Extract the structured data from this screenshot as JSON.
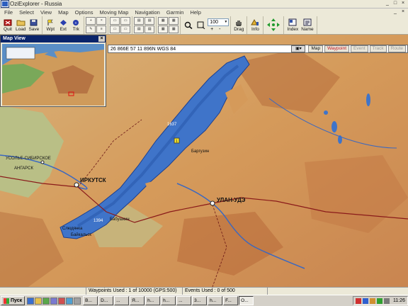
{
  "window": {
    "title": "OziExplorer - Russia",
    "controls": [
      "_",
      "□",
      "×"
    ]
  },
  "menu": {
    "items": [
      "File",
      "Select",
      "View",
      "Map",
      "Options",
      "Moving Map",
      "Navigation",
      "Garmin",
      "Help"
    ]
  },
  "toolbar": {
    "quit_label": "Quit",
    "load_label": "Load",
    "save_label": "Save",
    "wpt_label": "Wpt",
    "ext_label": "Ext",
    "trk_label": "Trk",
    "drag_label": "Drag",
    "info_label": "Info",
    "index_label": "Index",
    "name_label": "Name",
    "zoom_value": "100",
    "zoom_pm": "+-"
  },
  "mapview": {
    "title": "Map View",
    "close": "×"
  },
  "coords": {
    "text": "26 866E    57 11 896N  WGS 84",
    "modes": [
      "Map",
      "Waypoint",
      "Event",
      "Track",
      "Route"
    ],
    "active_mode": "Waypoint"
  },
  "map_labels": {
    "irkutsk": "ИРКУТСК",
    "ulan_ude": "УЛАН-УДЭ",
    "usolye": "УСОЛЬЕ-СИБИРСКОЕ",
    "angarsk": "АНГАРСК",
    "babushkin": "Бабушкин",
    "slyudyanka": "Слюдянка",
    "baikalsk": "Байкальск",
    "depth1": "1394",
    "depth2": "1637",
    "ulan_label": "Улан-Удэ",
    "barguzin": "Баргузин",
    "point_label": "1"
  },
  "statusbar": {
    "waypoints": "Waypoints Used : 1 of 10000  (GPS:500)",
    "events": "Events Used : 0 of 500"
  },
  "taskbar": {
    "start": "Пуск",
    "tasks": [
      "B...",
      "D...",
      "...",
      "Я...",
      "h...",
      "h...",
      "...",
      "3...",
      "h...",
      "F...",
      "O..."
    ],
    "active_task": "O...",
    "clock": "11:26"
  },
  "colors": {
    "water": "#3f74c9",
    "land": "#d9a468",
    "mountain": "#b86a3a",
    "active_mode": "#c0121c",
    "title_blue": "#0a246a"
  }
}
